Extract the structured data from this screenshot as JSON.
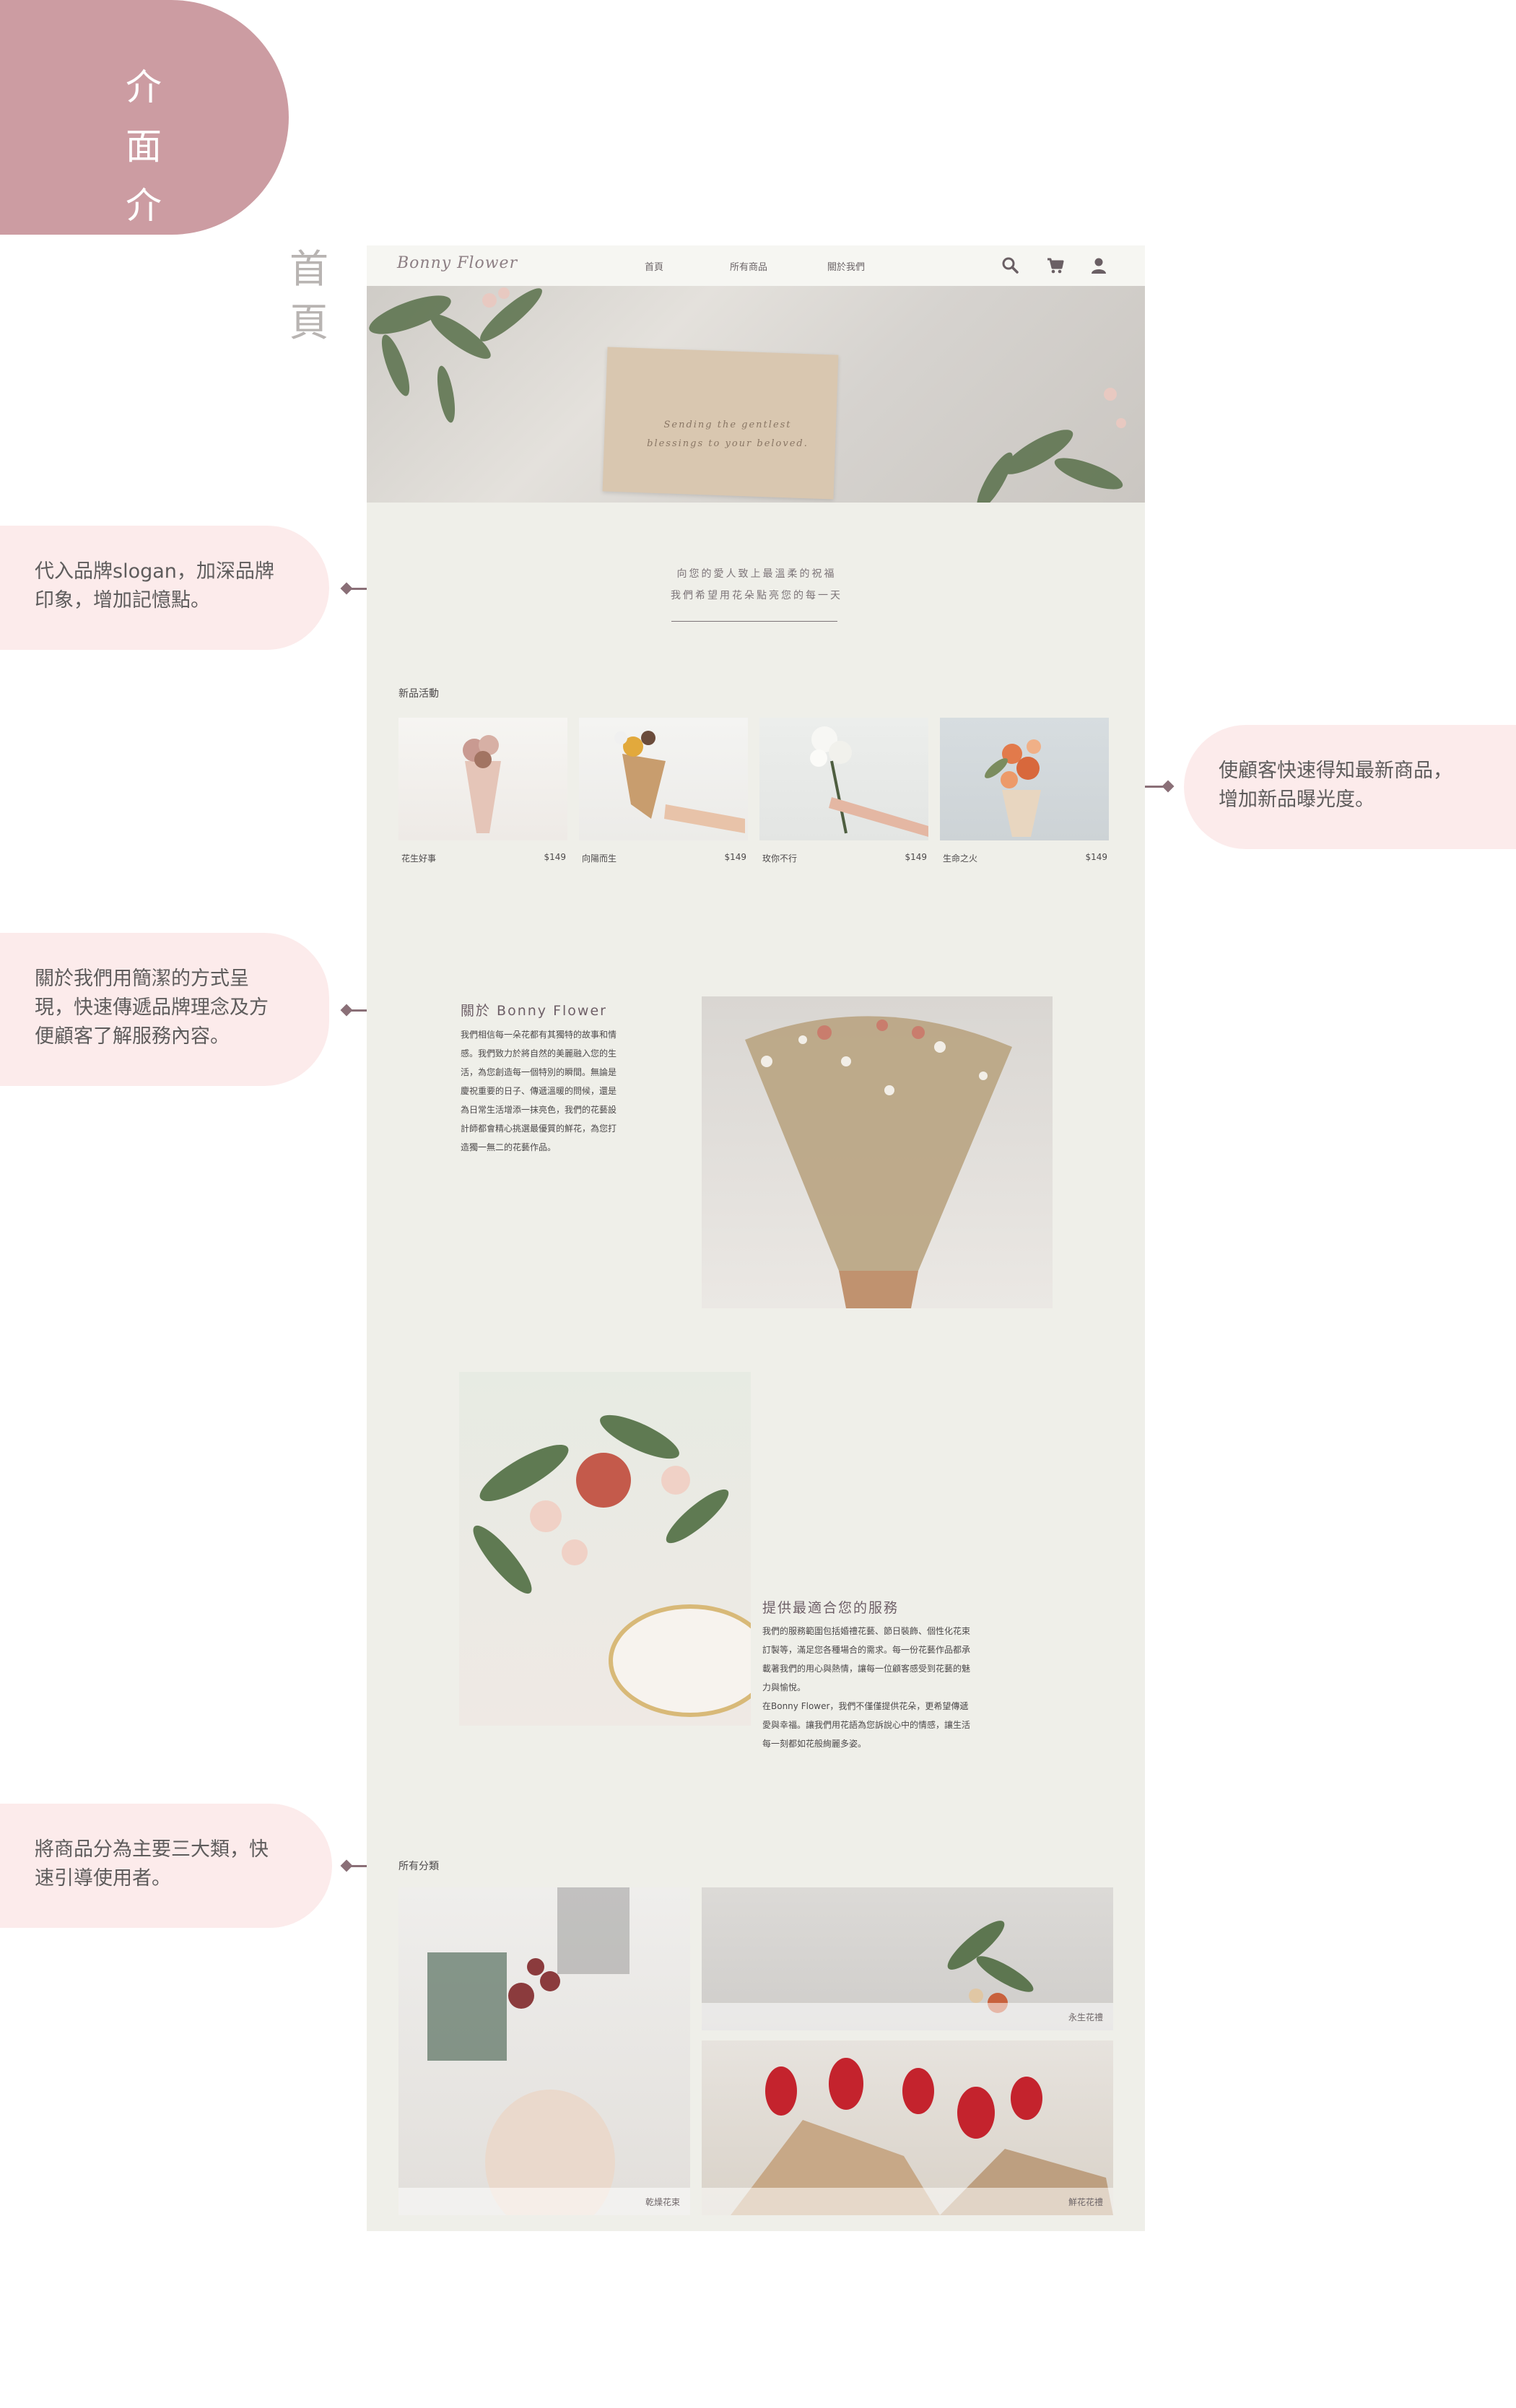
{
  "badge": {
    "line1": "介 面",
    "line2": "介 紹"
  },
  "page_label": {
    "line1": "首",
    "line2": "頁"
  },
  "callouts": {
    "slogan": {
      "line1": "代入品牌slogan，加深品牌",
      "line2": "印象，增加記憶點。"
    },
    "new": {
      "line1": "使顧客快速得知最新商品，",
      "line2": "增加新品曝光度。"
    },
    "about": {
      "line1": "關於我們用簡潔的方式呈",
      "line2": "現，快速傳遞品牌理念及方",
      "line3": "便顧客了解服務內容。"
    },
    "category": {
      "line1": "將商品分為主要三大類，快",
      "line2": "速引導使用者。"
    }
  },
  "site": {
    "brand": "Bonny Flower",
    "nav": {
      "home": "首頁",
      "products": "所有商品",
      "about": "關於我們"
    },
    "icons": {
      "search": "search-icon",
      "cart": "cart-icon",
      "user": "user-icon"
    },
    "hero": {
      "line1": "Sending the gentlest",
      "line2": "blessings to your beloved."
    },
    "slogan": {
      "line1": "向您的愛人致上最溫柔的祝福",
      "line2": "我們希望用花朵點亮您的每一天"
    },
    "new_title": "新品活動",
    "products": [
      {
        "name": "花生好事",
        "price": "$149"
      },
      {
        "name": "向陽而生",
        "price": "$149"
      },
      {
        "name": "玫你不行",
        "price": "$149"
      },
      {
        "name": "生命之火",
        "price": "$149"
      }
    ],
    "about_title": "關於 Bonny Flower",
    "about_lines": [
      "我們相信每一朵花都有其獨特的故事和情",
      "感。我們致力於將自然的美麗融入您的生",
      "活，為您創造每一個特別的瞬間。無論是",
      "慶祝重要的日子、傳遞溫暖的問候，還是",
      "為日常生活增添一抹亮色，我們的花藝設",
      "計師都會精心挑選最優質的鮮花，為您打",
      "造獨一無二的花藝作品。"
    ],
    "service_title": "提供最適合您的服務",
    "service_lines": [
      "我們的服務範圍包括婚禮花藝、節日裝飾、個性化花束",
      "訂製等，滿足您各種場合的需求。每一份花藝作品都承",
      "載著我們的用心與熱情，讓每一位顧客感受到花藝的魅",
      "力與愉悅。",
      "在Bonny Flower，我們不僅僅提供花朵，更希望傳遞",
      "愛與幸福。讓我們用花語為您訴說心中的情感，讓生活",
      "每一刻都如花般絢麗多姿。"
    ],
    "category_title": "所有分類",
    "categories": {
      "dried": "乾燥花束",
      "eternal": "永生花禮",
      "fresh": "鮮花花禮"
    }
  },
  "colors": {
    "badge": "#cc9ca2",
    "callout": "#fcebeb",
    "site_bg": "#efefe9",
    "accent": "#8a6f77"
  }
}
